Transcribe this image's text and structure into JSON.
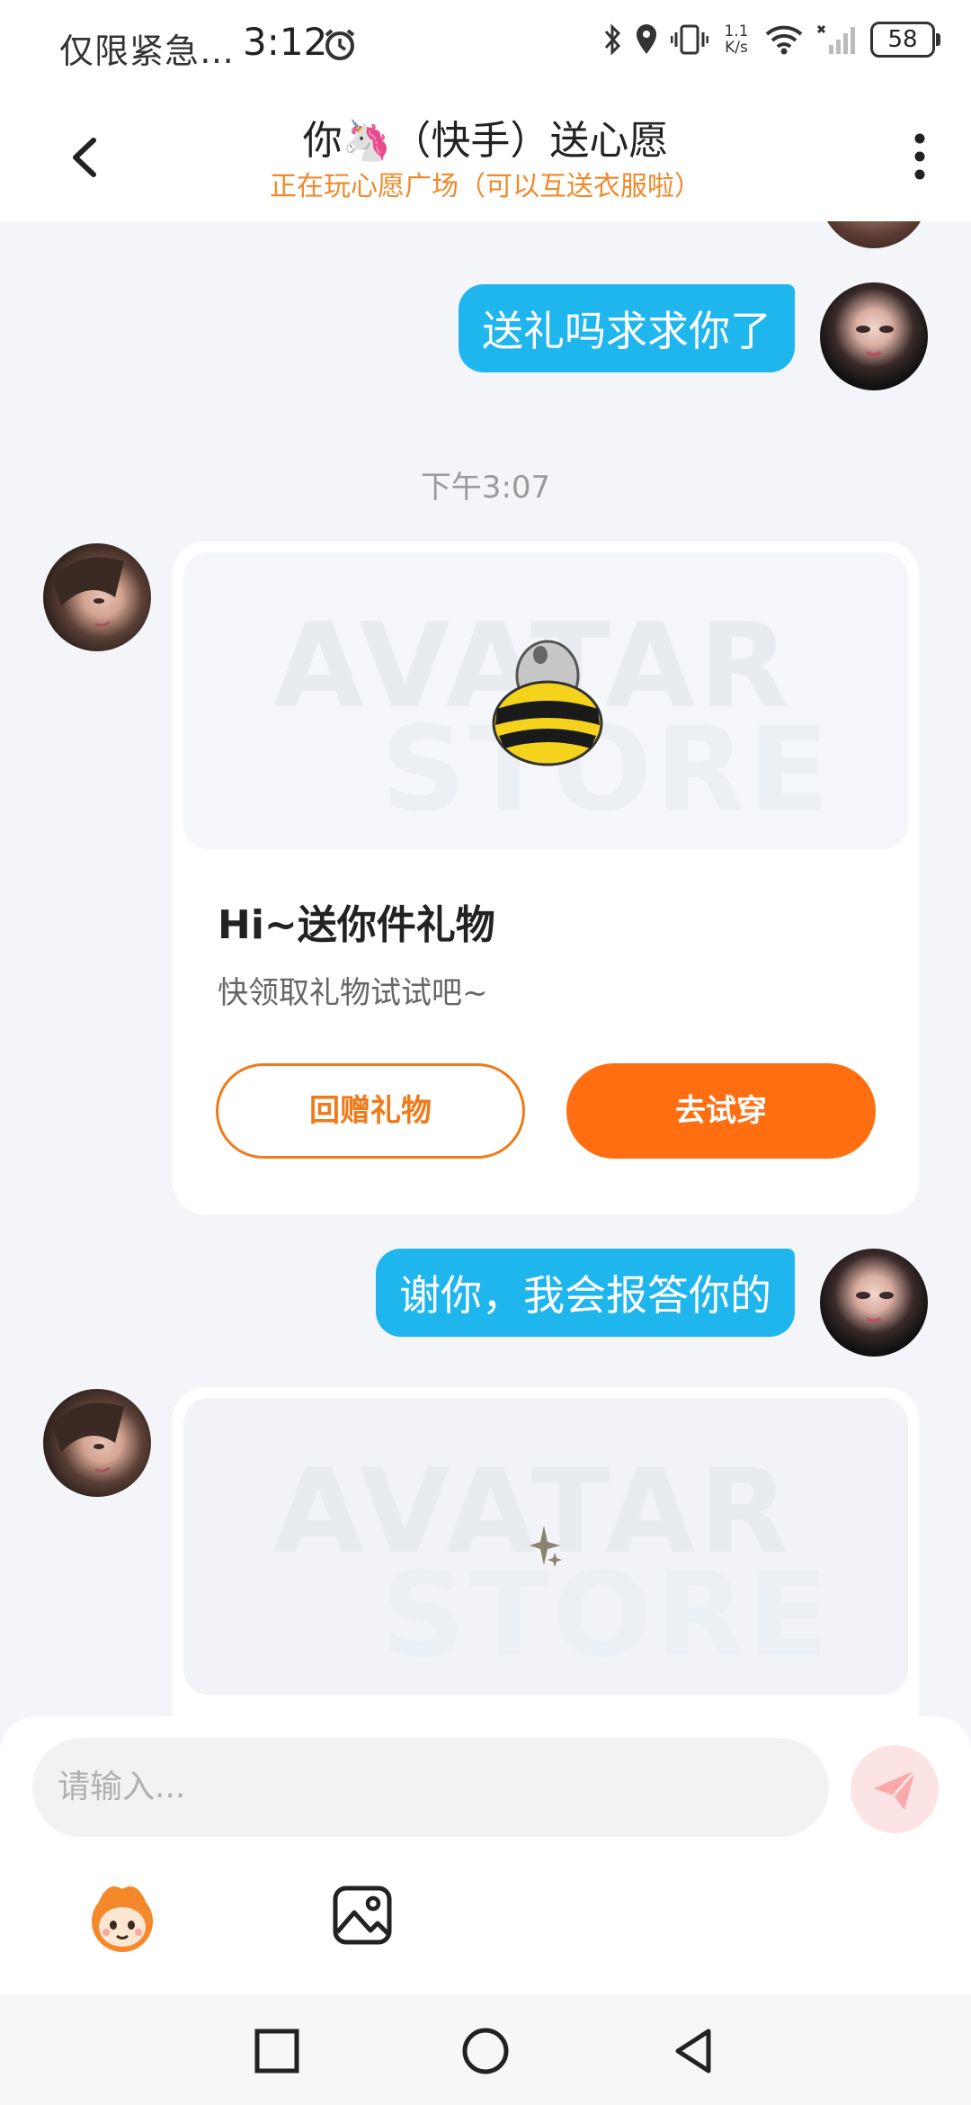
{
  "status_bar": {
    "carrier_text": "仅限紧急…",
    "time": "3:12",
    "speed_top": "1.1",
    "speed_bottom": "K/s",
    "battery": "58"
  },
  "header": {
    "title": "你🦄（快手）送心愿",
    "subtitle": "正在玩心愿广场（可以互送衣服啦）"
  },
  "messages": {
    "out_1": "送礼吗求求你了",
    "timestamp": "下午3:07",
    "gift_card": {
      "watermark_line1": "AVATAR",
      "watermark_line2": "STORE",
      "title": "Hi~送你件礼物",
      "desc": "快领取礼物试试吧~",
      "return_label": "回赠礼物",
      "try_label": "去试穿"
    },
    "out_2": "谢你，我会报答你的",
    "gift_card_2": {
      "watermark_line1": "AVATAR",
      "watermark_line2": "STORE"
    }
  },
  "input": {
    "placeholder": "请输入..."
  },
  "colors": {
    "accent_blue": "#1fb6ee",
    "accent_orange": "#ff6f12",
    "subtitle_orange": "#ef8a2c"
  },
  "icons": [
    "back-icon",
    "more-icon",
    "alarm-icon",
    "bluetooth-icon",
    "location-icon",
    "vibrate-icon",
    "wifi-icon",
    "signal-icon",
    "send-icon",
    "mascot-icon",
    "image-icon",
    "square-nav-icon",
    "circle-nav-icon",
    "triangle-nav-icon"
  ]
}
